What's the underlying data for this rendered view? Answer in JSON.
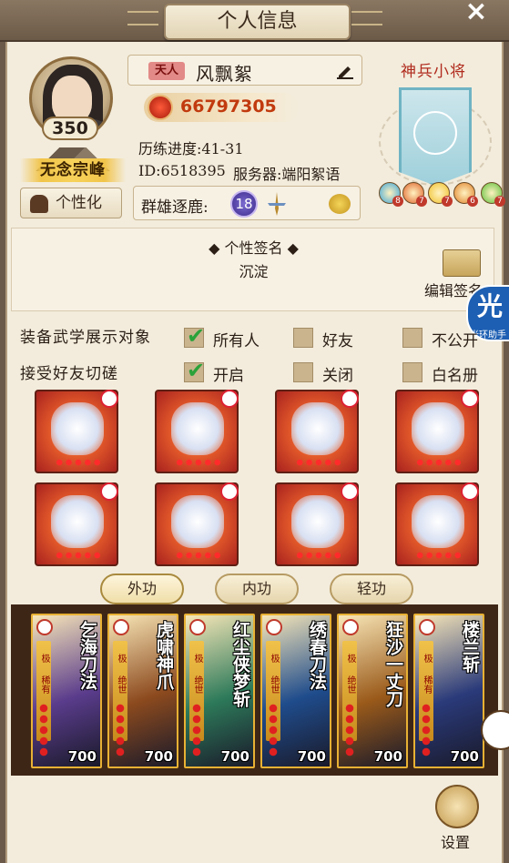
{
  "header": {
    "title": "个人信息",
    "close_icon": "×"
  },
  "profile": {
    "level": "350",
    "sect_name": "无念宗峰",
    "personalize_label": "个性化",
    "tier_tag": "天人",
    "player_name": "风飘絮",
    "power": "66797305",
    "progress": "历练进度:41-31",
    "id_text": "ID:6518395",
    "server_text": "服务器:端阳絮语",
    "qunxiong_label": "群雄逐鹿:",
    "qunxiong_rank": "18"
  },
  "weapon": {
    "title": "神兵小将",
    "orbs": [
      {
        "color": "#3aa4d8",
        "count": "8"
      },
      {
        "color": "#e0612a",
        "count": "7"
      },
      {
        "color": "#f0c02a",
        "count": "7"
      },
      {
        "color": "#e0812a",
        "count": "6"
      },
      {
        "color": "#5bbf3a",
        "count": "7"
      }
    ]
  },
  "signature": {
    "title": "个性签名",
    "text": "沉淀",
    "edit_label": "编辑签名"
  },
  "helper": {
    "big": "光",
    "small": "光环助手"
  },
  "settings_rows": [
    {
      "label": "装备武学展示对象",
      "options": [
        {
          "label": "所有人",
          "checked": true
        },
        {
          "label": "好友",
          "checked": false
        },
        {
          "label": "不公开",
          "checked": false
        }
      ]
    },
    {
      "label": "接受好友切磋",
      "options": [
        {
          "label": "开启",
          "checked": true
        },
        {
          "label": "关闭",
          "checked": false
        },
        {
          "label": "白名册",
          "checked": false
        }
      ]
    }
  ],
  "equipment": [
    {
      "item": "wrist-guard"
    },
    {
      "item": "robe"
    },
    {
      "item": "crown"
    },
    {
      "item": "boots"
    },
    {
      "item": "necklace"
    },
    {
      "item": "hairpin"
    },
    {
      "item": "bracelet"
    },
    {
      "item": "ring"
    }
  ],
  "tabs": [
    {
      "label": "外功",
      "active": true
    },
    {
      "label": "内功",
      "active": false
    },
    {
      "label": "轻功",
      "active": false
    }
  ],
  "martial_arts": [
    {
      "name": "乞海刀法",
      "tag1": "极",
      "tag2": "稀有",
      "power": "700",
      "bg": "#5a3c8c"
    },
    {
      "name": "虎啸神爪",
      "tag1": "极",
      "tag2": "绝世",
      "power": "700",
      "bg": "#8c4a1e"
    },
    {
      "name": "红尘侠梦斩",
      "tag1": "极",
      "tag2": "绝世",
      "power": "700",
      "bg": "#2d7a5a"
    },
    {
      "name": "绣春刀法",
      "tag1": "极",
      "tag2": "绝世",
      "power": "700",
      "bg": "#1f4c8c"
    },
    {
      "name": "狂沙一丈刀",
      "tag1": "极",
      "tag2": "绝世",
      "power": "700",
      "bg": "#9a5a1a"
    },
    {
      "name": "楼兰斩",
      "tag1": "极",
      "tag2": "稀有",
      "power": "700",
      "bg": "#2a3a7a"
    }
  ],
  "settings": {
    "label": "设置"
  }
}
